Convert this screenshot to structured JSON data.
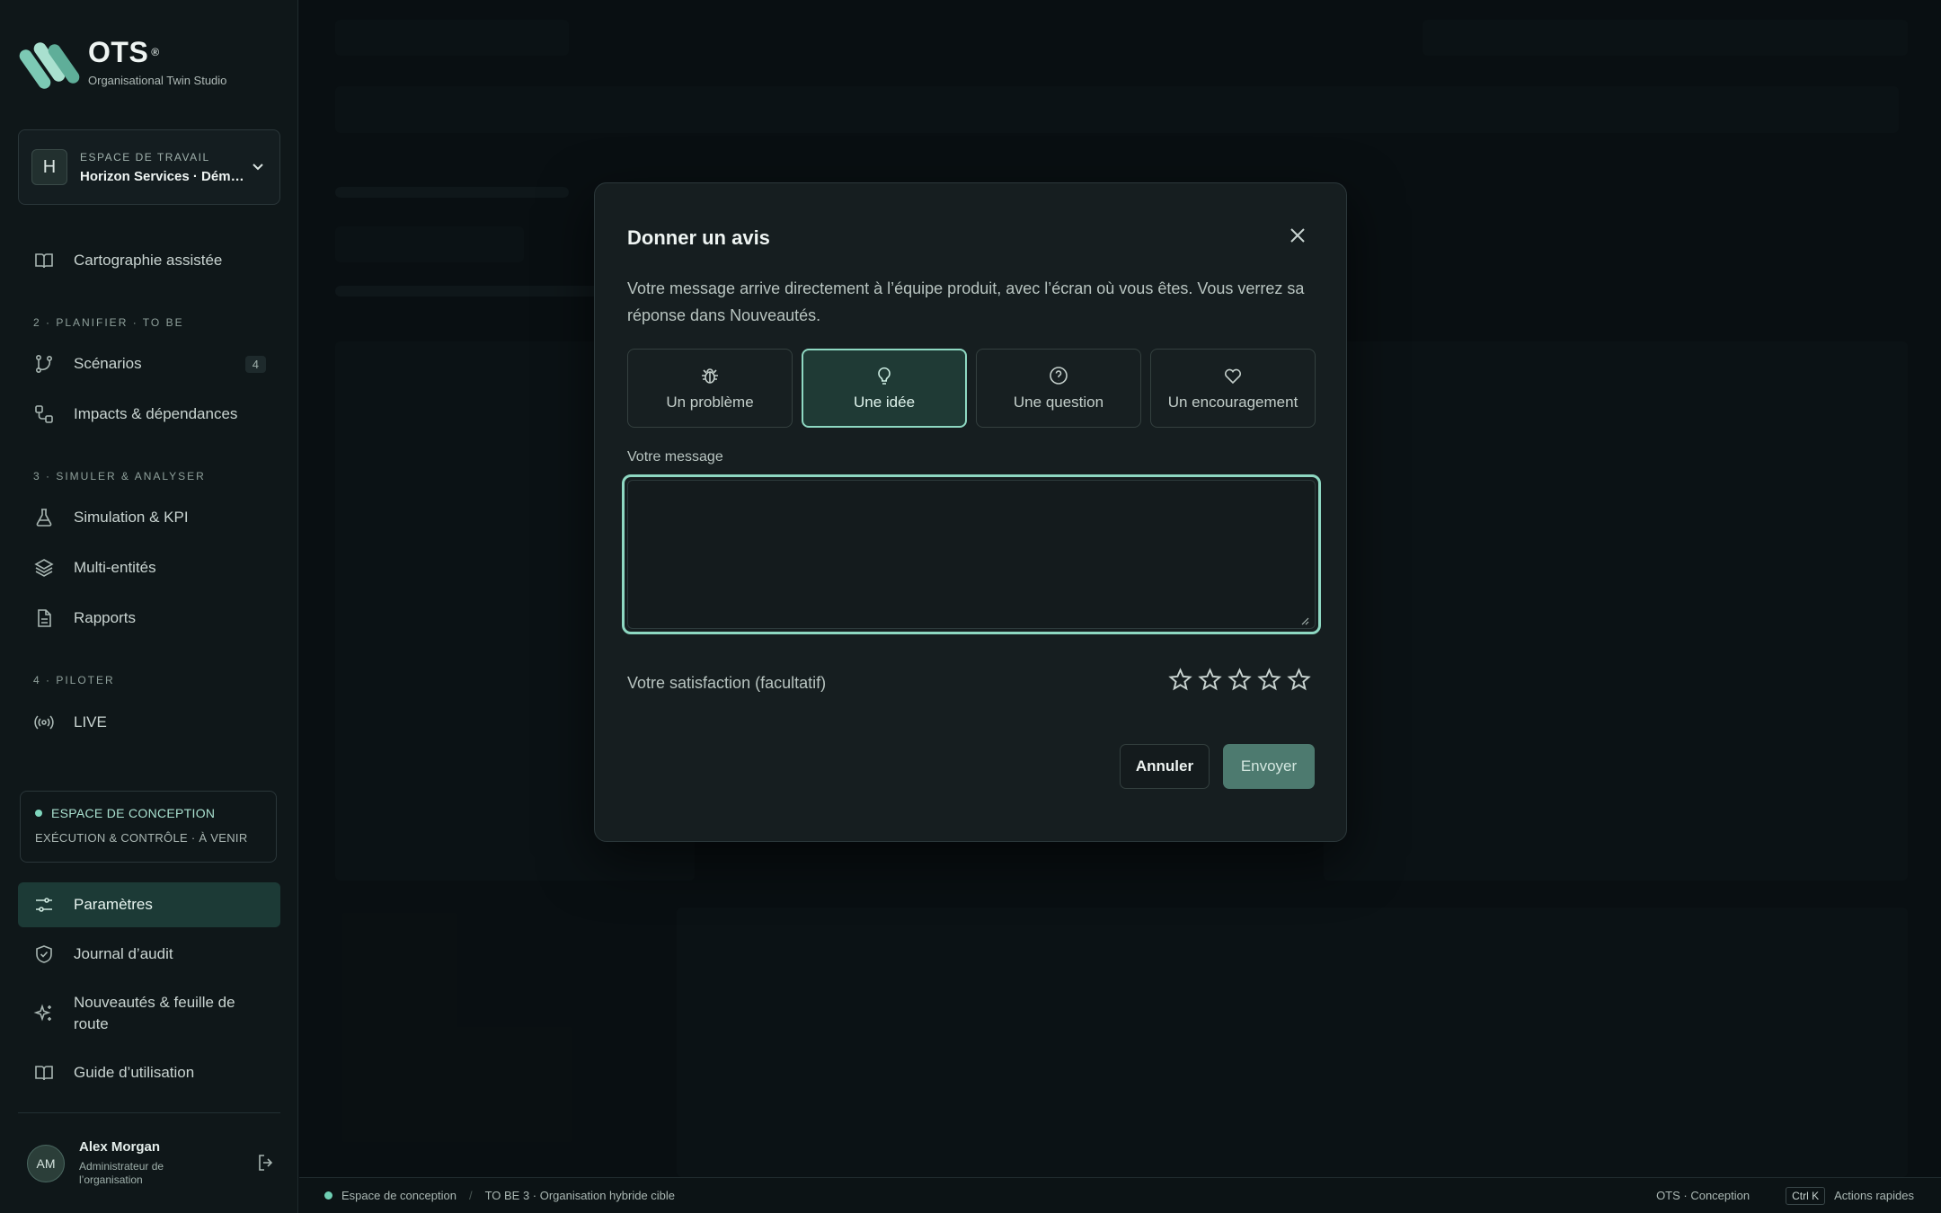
{
  "brand": {
    "title": "OTS",
    "registered": "®",
    "subtitle": "Organisational Twin Studio"
  },
  "workspace": {
    "avatar_letter": "H",
    "label": "ESPACE DE TRAVAIL",
    "name": "Horizon Services · Démonst..."
  },
  "nav": {
    "mapping": "Cartographie assistée",
    "section_plan": "2 · PLANIFIER · TO BE",
    "scenarios": "Scénarios",
    "scenarios_count": "4",
    "impacts": "Impacts & dépendances",
    "section_simulate": "3 · SIMULER & ANALYSER",
    "simulation": "Simulation & KPI",
    "multi": "Multi-entités",
    "reports": "Rapports",
    "section_pilot": "4 · PILOTER",
    "live": "LIVE",
    "settings": "Paramètres",
    "audit": "Journal d’audit",
    "news": "Nouveautés & feuille de route",
    "guide": "Guide d’utilisation"
  },
  "design_space": {
    "title": "ESPACE DE CONCEPTION",
    "subtitle": "EXÉCUTION & CONTRÔLE · À VENIR"
  },
  "user": {
    "initials": "AM",
    "name": "Alex Morgan",
    "role": "Administrateur de l’organisation"
  },
  "statusbar": {
    "space": "Espace de conception",
    "scenario": "TO BE 3 · Organisation hybride cible",
    "app": "OTS · Conception",
    "shortcut": "Ctrl K",
    "quick_actions": "Actions rapides"
  },
  "modal": {
    "title": "Donner un avis",
    "description": "Votre message arrive directement à l’équipe produit, avec l’écran où vous êtes. Vous verrez sa réponse dans Nouveautés.",
    "types": [
      {
        "label": "Un problème",
        "icon": "bug-icon",
        "selected": false
      },
      {
        "label": "Une idée",
        "icon": "lightbulb-icon",
        "selected": true
      },
      {
        "label": "Une question",
        "icon": "question-icon",
        "selected": false
      },
      {
        "label": "Un encouragement",
        "icon": "heart-icon",
        "selected": false
      }
    ],
    "message_label": "Votre message",
    "message_value": "",
    "satisfaction_label": "Votre satisfaction (facultatif)",
    "rating": 0,
    "rating_max": 5,
    "cancel_label": "Annuler",
    "send_label": "Envoyer"
  },
  "colors": {
    "accent": "#8ed8c2",
    "active_bg": "#1c3a36",
    "send_bg": "#4d7a6f"
  }
}
